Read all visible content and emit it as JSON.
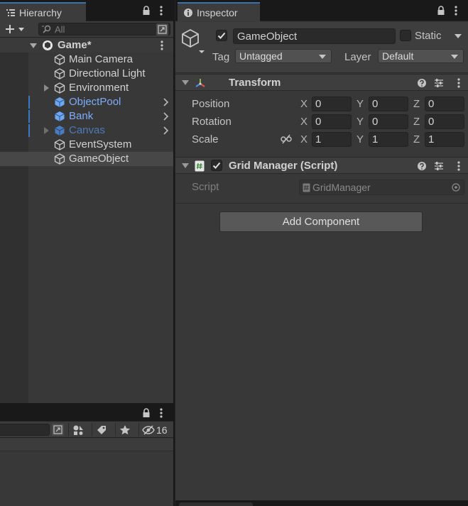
{
  "hierarchy": {
    "tab_title": "Hierarchy",
    "search_placeholder": "All",
    "items": [
      {
        "label": "Game*"
      },
      {
        "label": "Main Camera"
      },
      {
        "label": "Directional Light"
      },
      {
        "label": "Environment"
      },
      {
        "label": "ObjectPool"
      },
      {
        "label": "Bank"
      },
      {
        "label": "Canvas"
      },
      {
        "label": "EventSystem"
      },
      {
        "label": "GameObject"
      }
    ]
  },
  "project": {
    "hidden_count": "16"
  },
  "inspector": {
    "tab_title": "Inspector",
    "object_name": "GameObject",
    "static_label": "Static",
    "tag_label": "Tag",
    "tag_value": "Untagged",
    "layer_label": "Layer",
    "layer_value": "Default",
    "transform": {
      "title": "Transform",
      "position_label": "Position",
      "rotation_label": "Rotation",
      "scale_label": "Scale",
      "axes": [
        "X",
        "Y",
        "Z"
      ],
      "position": [
        "0",
        "0",
        "0"
      ],
      "rotation": [
        "0",
        "0",
        "0"
      ],
      "scale": [
        "1",
        "1",
        "1"
      ]
    },
    "grid_manager": {
      "title": "Grid Manager (Script)",
      "script_label": "Script",
      "script_value": "GridManager"
    },
    "add_component_label": "Add Component"
  },
  "colors": {
    "accent_blue": "#3a72b0",
    "prefab_blue": "#7cacf8",
    "panel_bg": "#383838"
  },
  "icons": {
    "hierarchy_tab": "hierarchy-list-icon",
    "inspector_tab": "info-icon",
    "lock": "lock-icon",
    "menu": "kebab-menu-icon",
    "help": "help-icon",
    "presets": "sliders-icon",
    "transform": "transform-axes-icon",
    "script": "script-hash-icon",
    "constrain": "unlink-icon",
    "object_picker": "target-icon"
  }
}
